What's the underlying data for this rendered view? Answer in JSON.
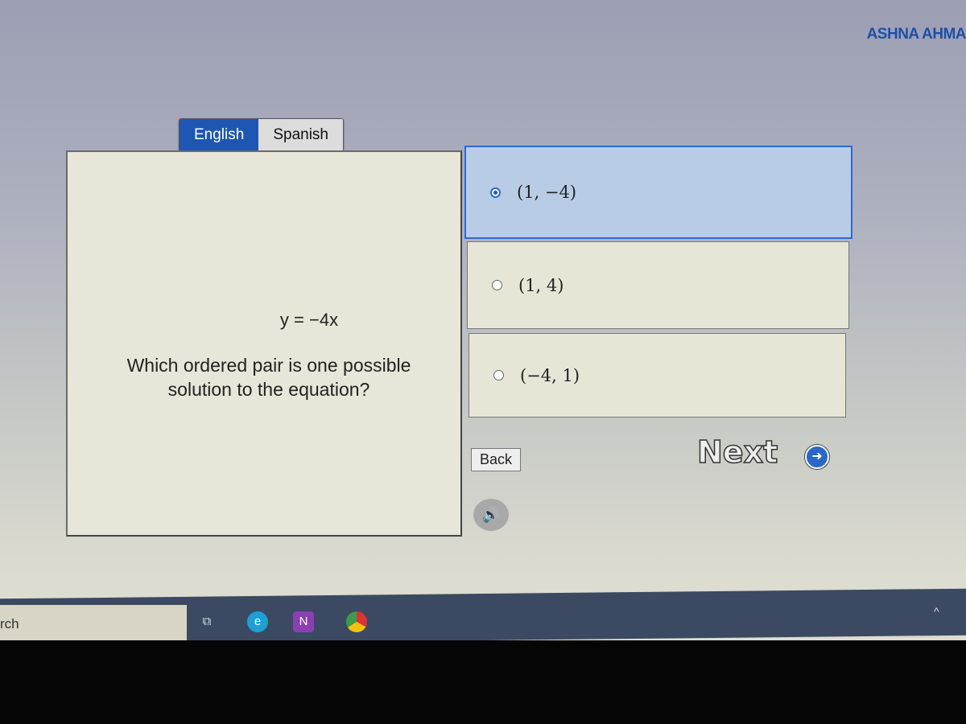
{
  "header": {
    "user_name": "ASHNA AHMA"
  },
  "language_tabs": [
    {
      "label": "English",
      "selected": true
    },
    {
      "label": "Spanish",
      "selected": false
    }
  ],
  "question": {
    "equation": "y = −4x",
    "prompt": "Which ordered pair is one possible solution to the equation?"
  },
  "options": [
    {
      "label": "(1, −4)",
      "selected": true
    },
    {
      "label": "(1, 4)",
      "selected": false
    },
    {
      "label": "(−4, 1)",
      "selected": false
    }
  ],
  "nav": {
    "back_label": "Back",
    "next_label": "Next"
  },
  "icons": {
    "next": "arrow-right-circle-icon",
    "audio": "speaker-icon"
  },
  "taskbar": {
    "search_text": "rch",
    "apps": [
      "task-view-icon",
      "edge-icon",
      "onenote-icon",
      "chrome-icon"
    ],
    "tray": "chevron-up-icon"
  },
  "colors": {
    "accent": "#1e56b4",
    "selected_option": "#b8cce6",
    "user_name": "#1f4fa6"
  }
}
